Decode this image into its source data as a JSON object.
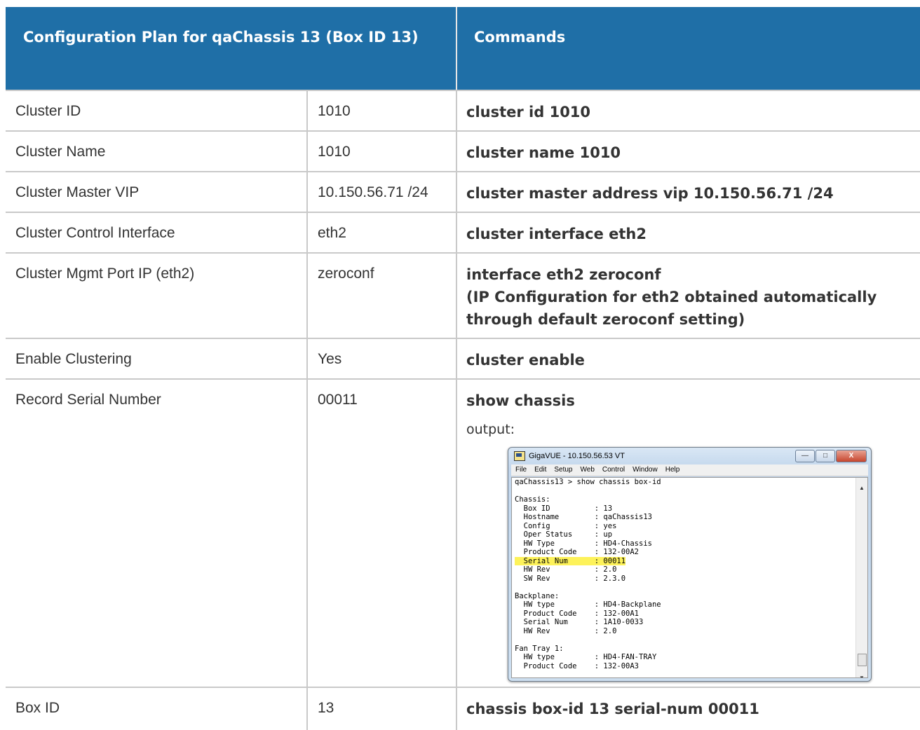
{
  "header": {
    "col1": "Configuration Plan for qaChassis 13 (Box ID 13)",
    "col2": "Commands"
  },
  "rows": [
    {
      "label": "Cluster ID",
      "value": "1010",
      "command": "cluster id 1010"
    },
    {
      "label": "Cluster Name",
      "value": "1010",
      "command": "cluster name 1010"
    },
    {
      "label": "Cluster Master VIP",
      "value": "10.150.56.71 /24",
      "command": "cluster master address vip 10.150.56.71 /24"
    },
    {
      "label": "Cluster Control Interface",
      "value": "eth2",
      "command": "cluster interface eth2"
    },
    {
      "label": "Cluster Mgmt Port IP (eth2)",
      "value": "zeroconf",
      "command": "interface eth2 zeroconf",
      "note": "(IP Configuration for eth2 obtained automatically through default zeroconf setting)"
    },
    {
      "label": "Enable Clustering",
      "value": "Yes",
      "command": "cluster enable"
    },
    {
      "label": "Record Serial Number",
      "value": "00011",
      "command": "show chassis",
      "output_label": "output:"
    },
    {
      "label": "Box ID",
      "value": "13",
      "command": "chassis box-id 13 serial-num 00011"
    }
  ],
  "terminal": {
    "title": "GigaVUE - 10.150.56.53 VT",
    "menu": [
      "File",
      "Edit",
      "Setup",
      "Web",
      "Control",
      "Window",
      "Help"
    ],
    "lines_before": "qaChassis13 > show chassis box-id\n\nChassis:\n  Box ID          : 13\n  Hostname        : qaChassis13\n  Config          : yes\n  Oper Status     : up\n  HW Type         : HD4-Chassis\n  Product Code    : 132-00A2",
    "highlight_line": "  Serial Num      : 00011",
    "lines_after": "  HW Rev          : 2.0\n  SW Rev          : 2.3.0\n\nBackplane:\n  HW type         : HD4-Backplane\n  Product Code    : 132-00A1\n  Serial Num      : 1A10-0033\n  HW Rev          : 2.0\n\nFan Tray 1:\n  HW type         : HD4-FAN-TRAY\n  Product Code    : 132-00A3"
  }
}
